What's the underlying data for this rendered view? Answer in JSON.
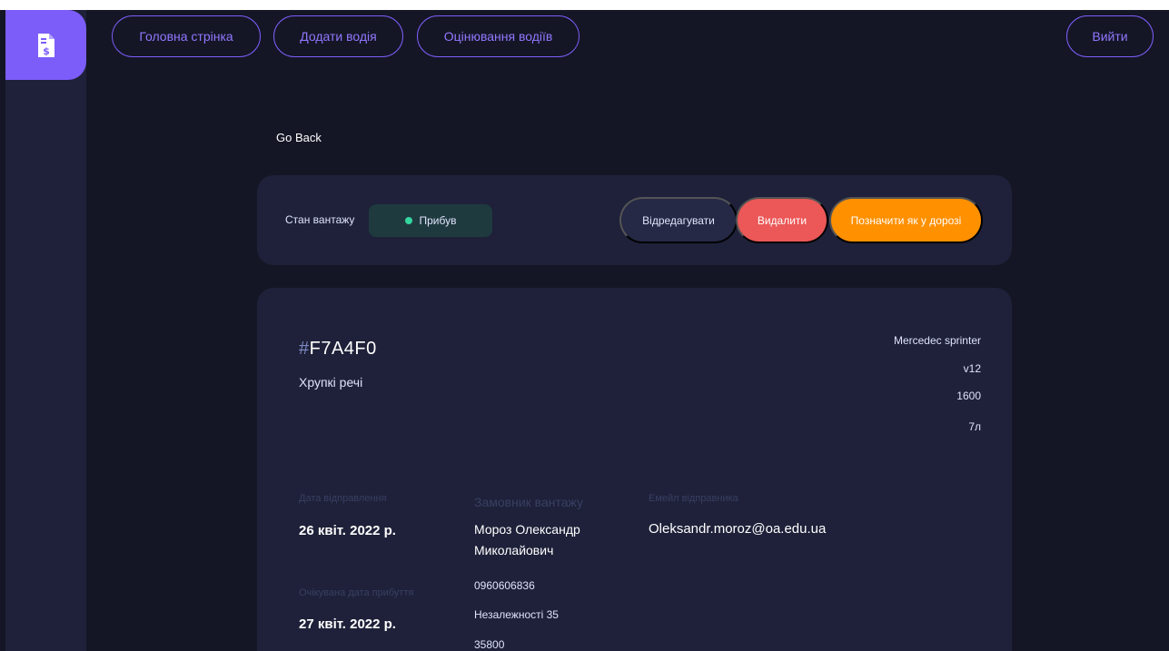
{
  "nav": {
    "home": "Головна стрінка",
    "add_driver": "Додати водія",
    "rate_drivers": "Оцінювання водіїв",
    "logout": "Вийти"
  },
  "go_back": "Go Back",
  "status": {
    "label": "Стан вантажу",
    "value": "Прибув",
    "color": "#33d69f"
  },
  "actions": {
    "edit": "Відредагувати",
    "delete": "Видалити",
    "mark": "Позначити як у дорозі"
  },
  "cargo": {
    "hash": "#",
    "id": "F7A4F0",
    "description": "Хрупкі речі",
    "vehicle": {
      "model": "Mercedec sprinter",
      "engine": "v12",
      "weight": "1600",
      "volume": "7л"
    },
    "sent_date_label": "Дата відправлення",
    "sent_date": "26 квіт. 2022 р.",
    "arrival_date_label": "Очікувана дата прибуття",
    "arrival_date": "27 квіт. 2022 р.",
    "customer_label": "Замовник вантажу",
    "customer_name": "Мороз Олександр Миколайович",
    "customer_phone": "0960606836",
    "customer_street": "Незалежності 35",
    "customer_zip": "35800",
    "sender_email_label": "Емейл відправника",
    "sender_email": "Oleksandr.moroz@oa.edu.ua"
  },
  "colors": {
    "accent": "#7c5dfa",
    "danger": "#ec5757",
    "warning": "#ff9000",
    "background": "#141625",
    "card": "#1e2139"
  }
}
